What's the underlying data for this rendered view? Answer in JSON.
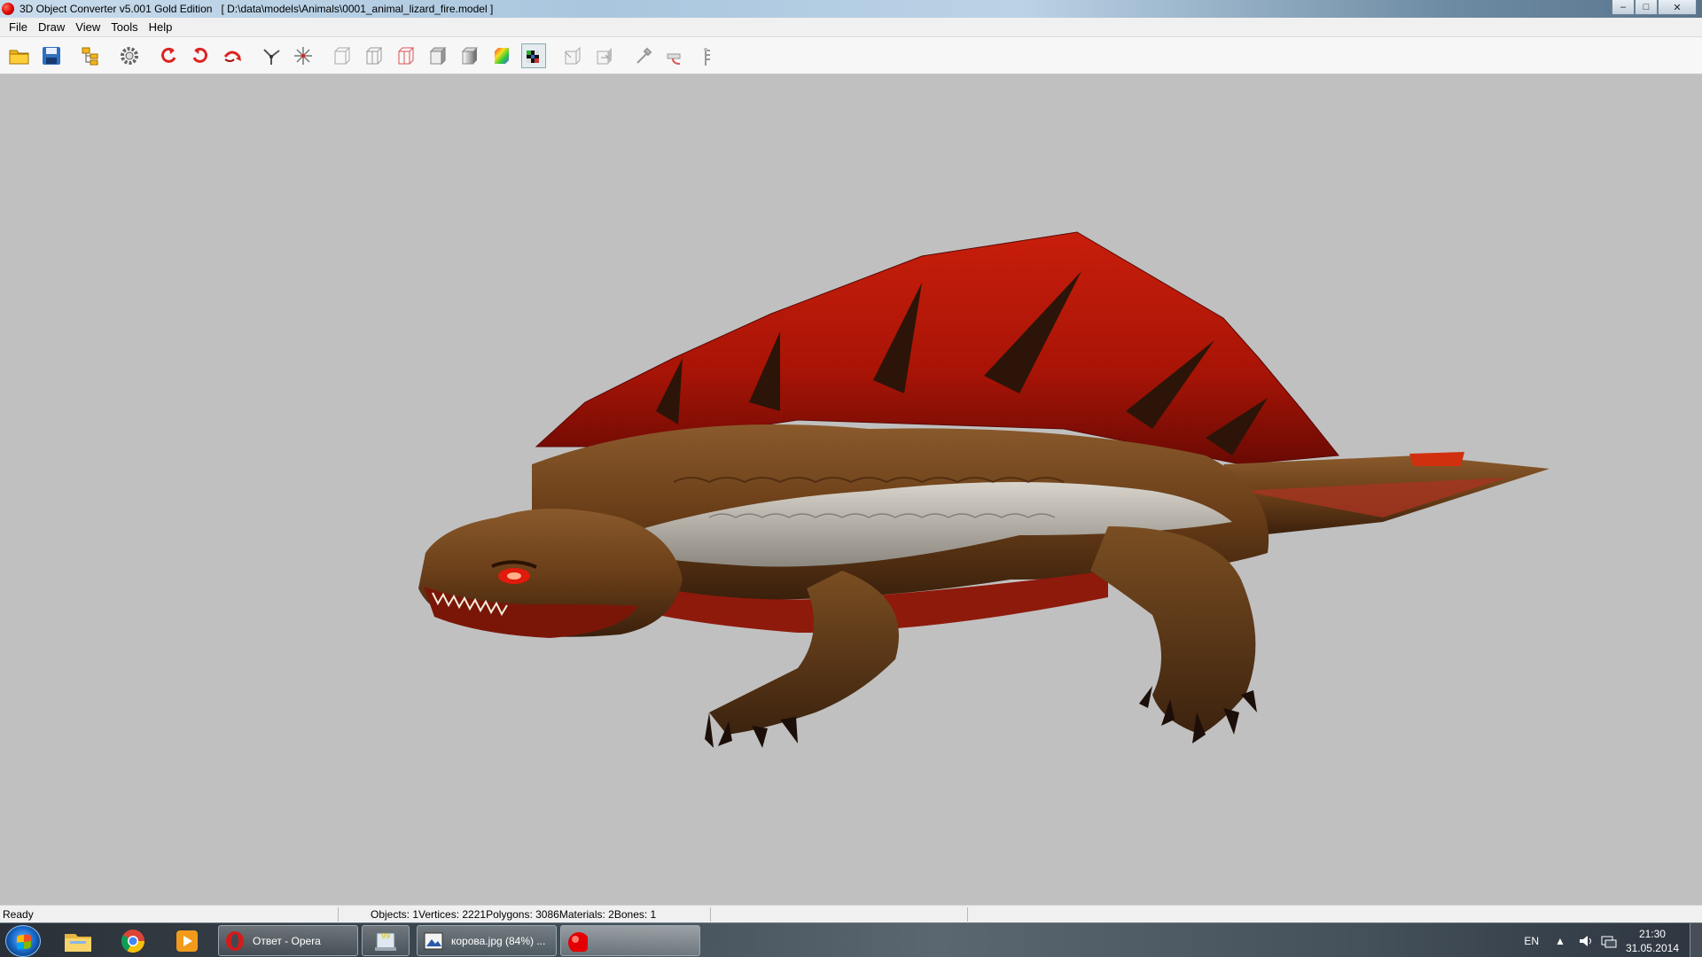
{
  "window": {
    "app_title": "3D Object Converter v5.001 Gold Edition",
    "document": "[ D:\\data\\models\\Animals\\0001_animal_lizard_fire.model ]",
    "controls": {
      "minimize": "–",
      "maximize": "□",
      "close": "✕"
    }
  },
  "menu": [
    "File",
    "Draw",
    "View",
    "Tools",
    "Help"
  ],
  "toolbar": {
    "buttons": [
      "open-folder-icon",
      "save-icon",
      "hierarchy-icon",
      "settings-gear-icon",
      "rotate-left-icon",
      "rotate-right-icon",
      "rotate-free-icon",
      "axes-icon",
      "move-icon",
      "wireframe-icon",
      "wireframe-box-icon",
      "wireframe-red-icon",
      "flat-shade-icon",
      "smooth-shade-icon",
      "color-icon",
      "texture-icon",
      "normals-icon",
      "backface-icon",
      "light-icon",
      "camera-icon",
      "bones-icon"
    ],
    "pressed": "texture-icon"
  },
  "viewport": {
    "background": "#c0c0c0"
  },
  "status": {
    "ready": "Ready",
    "objects": "Objects: 1",
    "vertices": "Vertices: 2221",
    "polygons": "Polygons: 3086",
    "materials": "Materials: 2",
    "bones": "Bones: 1"
  },
  "taskbar": {
    "tasks": [
      {
        "label": "Ответ - Opera",
        "icon": "opera-icon"
      },
      {
        "label": "",
        "icon": "notepad-icon"
      },
      {
        "label": "корова.jpg (84%) ...",
        "icon": "image-viewer-icon"
      },
      {
        "label": "",
        "icon": "3d-object-converter-icon"
      }
    ],
    "pinned": [
      "explorer-icon",
      "chrome-icon",
      "media-player-icon"
    ],
    "tray": {
      "language": "EN",
      "time": "21:30",
      "date": "31.05.2014"
    }
  }
}
